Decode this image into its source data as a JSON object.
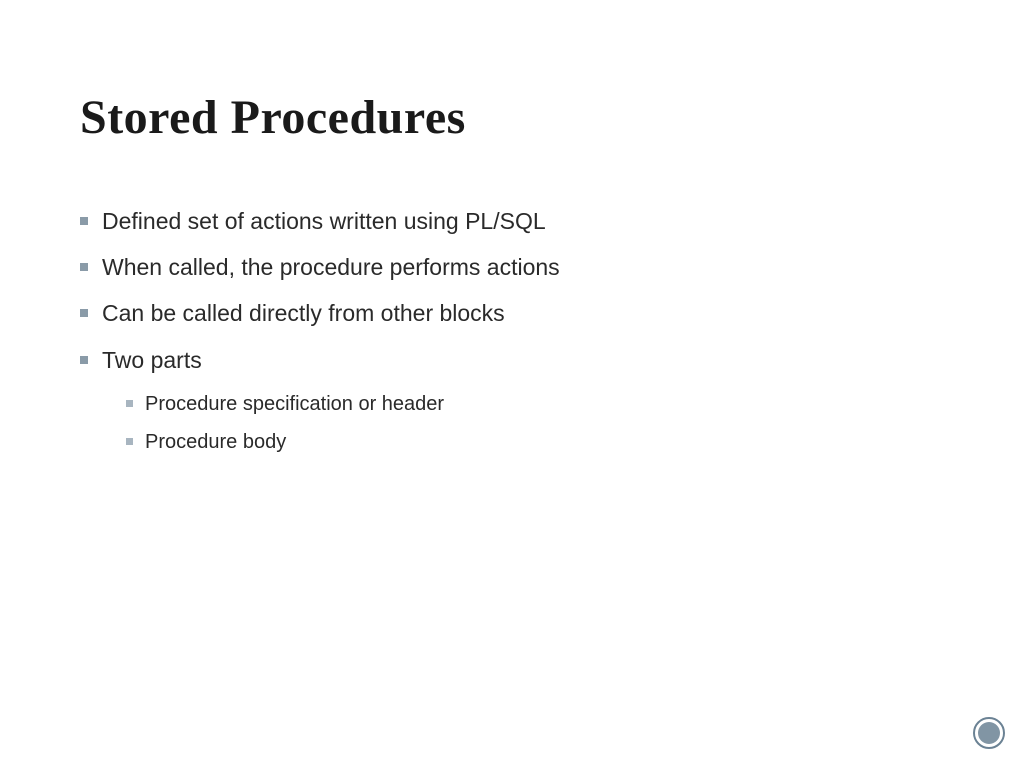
{
  "slide": {
    "title": "Stored Procedures",
    "bullets": [
      {
        "text": "Defined set of actions written using PL/SQL"
      },
      {
        "text": "When called, the procedure performs actions"
      },
      {
        "text": "Can be called directly from other blocks"
      },
      {
        "text": "Two parts",
        "sub": [
          {
            "text": "Procedure specification or header"
          },
          {
            "text": "Procedure body"
          }
        ]
      }
    ]
  }
}
